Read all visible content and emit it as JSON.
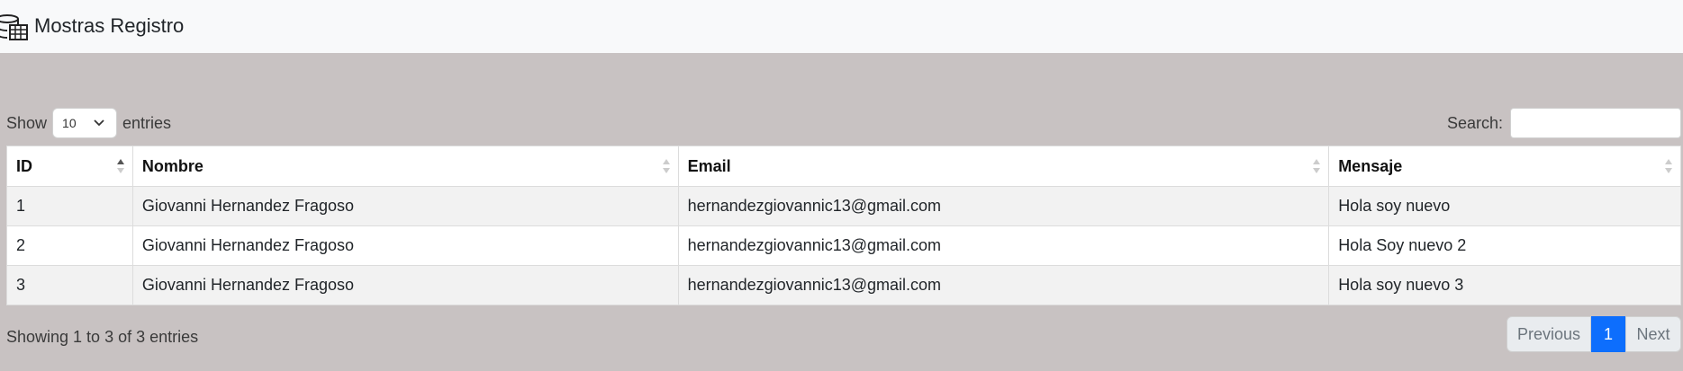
{
  "header": {
    "title": "Mostras Registro",
    "icon": "database-table-icon"
  },
  "controls": {
    "show_label": "Show",
    "entries_label": "entries",
    "page_length_value": "10",
    "search_label": "Search:",
    "search_value": ""
  },
  "table": {
    "columns": [
      "ID",
      "Nombre",
      "Email",
      "Mensaje"
    ],
    "sorted_column": "ID",
    "sort_direction": "ascending",
    "rows": [
      {
        "id": "1",
        "nombre": "Giovanni Hernandez Fragoso",
        "email": "hernandezgiovannic13@gmail.com",
        "mensaje": "Hola soy nuevo"
      },
      {
        "id": "2",
        "nombre": "Giovanni Hernandez Fragoso",
        "email": "hernandezgiovannic13@gmail.com",
        "mensaje": "Hola Soy nuevo 2"
      },
      {
        "id": "3",
        "nombre": "Giovanni Hernandez Fragoso",
        "email": "hernandezgiovannic13@gmail.com",
        "mensaje": "Hola soy nuevo 3"
      }
    ]
  },
  "footer": {
    "info": "Showing 1 to 3 of 3 entries",
    "previous_label": "Previous",
    "current_page": "1",
    "next_label": "Next"
  },
  "colors": {
    "background": "#c8c2c2",
    "navbar": "#f8f9fa",
    "accent": "#0d6efd"
  }
}
